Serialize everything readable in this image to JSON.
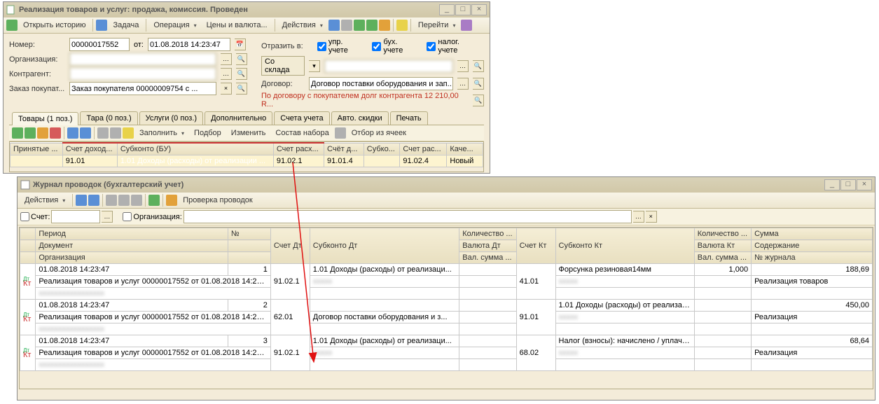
{
  "win1": {
    "title": "Реализация товаров и услуг: продажа, комиссия. Проведен",
    "toolbar": {
      "open_history": "Открыть историю",
      "task": "Задача",
      "operation": "Операция",
      "prices": "Цены и валюта...",
      "actions": "Действия",
      "goto": "Перейти"
    },
    "fields": {
      "number_lbl": "Номер:",
      "number": "00000017552",
      "from_lbl": "от:",
      "date": "01.08.2018 14:23:47",
      "org_lbl": "Организация:",
      "org": "",
      "counter_lbl": "Контрагент:",
      "counter": "",
      "order_lbl": "Заказ покупат...",
      "order": "Заказ покупателя 00000009754 с ...",
      "reflect_lbl": "Отразить в:",
      "chk_upr": "упр. учете",
      "chk_buh": "бух. учете",
      "chk_nal": "налог. учете",
      "wh_lbl": "Со склада",
      "wh": "",
      "contract_lbl": "Договор:",
      "contract": "Договор поставки оборудования и зап...",
      "debt": "По договору с покупателем долг контрагента 12 210,00 R..."
    },
    "tabs": [
      "Товары (1 поз.)",
      "Тара (0 поз.)",
      "Услуги (0 поз.)",
      "Дополнительно",
      "Счета учета",
      "Авто. скидки",
      "Печать"
    ],
    "subbar": {
      "fill": "Заполнить",
      "select": "Подбор",
      "change": "Изменить",
      "compose": "Состав набора",
      "filter": "Отбор из ячеек"
    },
    "grid": {
      "headers": [
        "Принятые ...",
        "Счет доход...",
        "Субконто (БУ)",
        "Счет расх...",
        "Счёт д...",
        "Субко...",
        "Счет рас...",
        "Каче..."
      ],
      "row": {
        "acct": "91.01",
        "sub": "1.01 Доходы (расходы) от реализации ...",
        "exp": "91.02.1",
        "d": "91.01.4",
        "sub2": "",
        "exp2": "91.02.4",
        "qual": "Новый"
      }
    }
  },
  "win2": {
    "title": "Журнал проводок (бухгалтерский учет)",
    "toolbar": {
      "actions": "Действия",
      "check": "Проверка проводок",
      "acct_lbl": "Счет:",
      "org_lbl": "Организация:"
    },
    "headers": {
      "r1": [
        "",
        "Период",
        "№",
        "Счет Дт",
        "Субконто Дт",
        "Количество ...",
        "Счет Кт",
        "Субконто Кт",
        "Количество ...",
        "Сумма"
      ],
      "r2": [
        "",
        "Документ",
        "",
        "",
        "",
        "Валюта Дт",
        "",
        "",
        "Валюта Кт",
        "Содержание"
      ],
      "r3": [
        "",
        "Организация",
        "",
        "",
        "",
        "Вал. сумма ...",
        "",
        "",
        "Вал. сумма ...",
        "№ журнала"
      ]
    },
    "rows": [
      {
        "period": "01.08.2018 14:23:47",
        "no": "1",
        "acct_dt": "91.02.1",
        "sub_dt": "1.01 Доходы (расходы) от реализаци...",
        "qty_dt": "",
        "acct_kt": "41.01",
        "sub_kt": "Форсунка  резиновая14мм",
        "qty_kt": "1,000",
        "sum": "188,69",
        "doc": "Реализация товаров и услуг 00000017552 от 01.08.2018 14:23:47",
        "content": "Реализация товаров",
        "org": "",
        "jn": ""
      },
      {
        "period": "01.08.2018 14:23:47",
        "no": "2",
        "acct_dt": "62.01",
        "sub_dt": "",
        "qty_dt": "",
        "acct_kt": "91.01",
        "sub_kt": "1.01 Доходы (расходы) от реализаци...",
        "qty_kt": "",
        "sum": "450,00",
        "doc": "Реализация товаров и услуг 00000017552 от 01.08.2018 14:23:47",
        "sub_dt2": "Договор поставки оборудования и з...",
        "content": "Реализация",
        "org": "",
        "jn": ""
      },
      {
        "period": "01.08.2018 14:23:47",
        "no": "3",
        "acct_dt": "91.02.1",
        "sub_dt": "1.01 Доходы (расходы) от реализаци...",
        "qty_dt": "",
        "acct_kt": "68.02",
        "sub_kt": "Налог (взносы): начислено / уплачено",
        "qty_kt": "",
        "sum": "68,64",
        "doc": "Реализация товаров и услуг 00000017552 от 01.08.2018 14:23:47",
        "content": "Реализация",
        "org": "",
        "jn": ""
      }
    ]
  }
}
